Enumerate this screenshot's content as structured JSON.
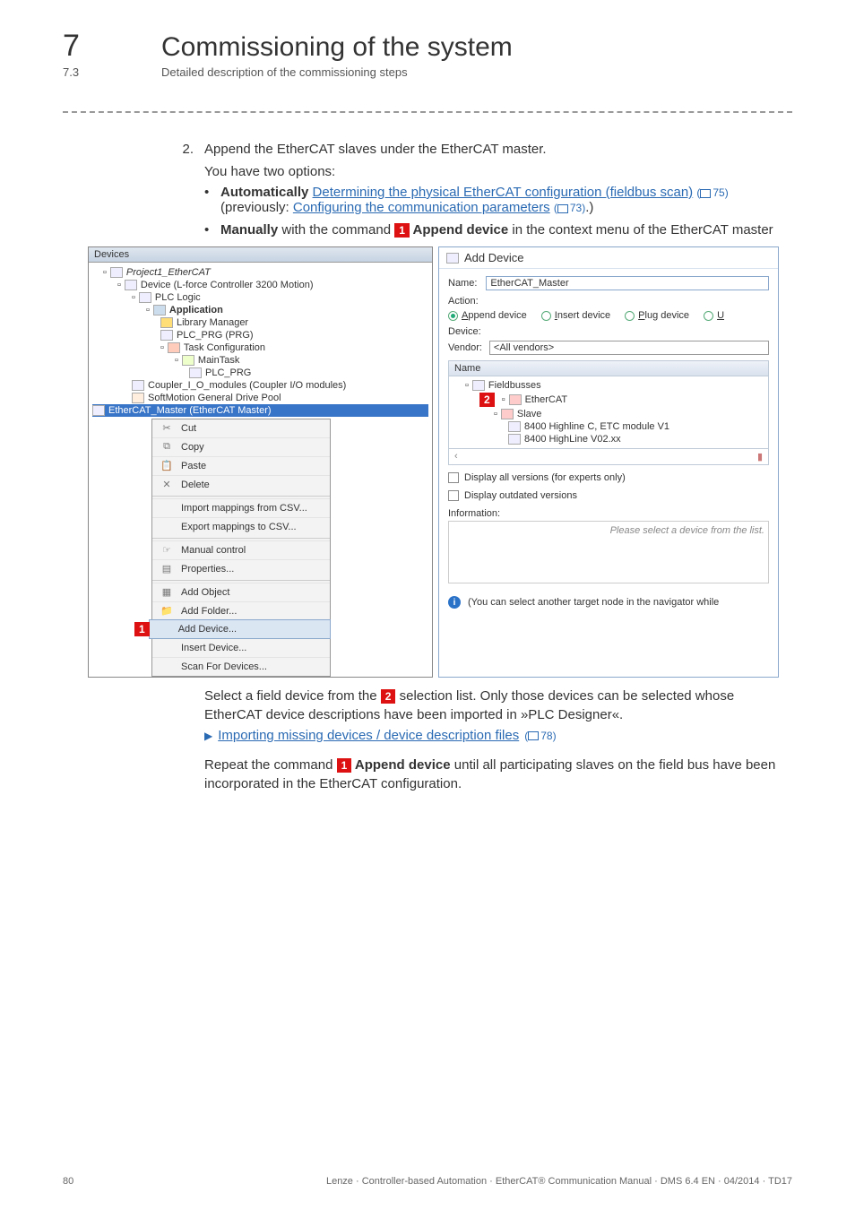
{
  "header": {
    "chapter_num": "7",
    "chapter_title": "Commissioning of the system",
    "section_num": "7.3",
    "section_title": "Detailed description of the commissioning steps"
  },
  "step": {
    "num": "2.",
    "text": "Append the EtherCAT slaves under the EtherCAT master.",
    "options_intro": "You have two options:",
    "auto_label": "Automatically",
    "auto_link": "Determining the physical EtherCAT configuration (fieldbus scan)",
    "auto_ref": "75",
    "prev_text": "(previously:",
    "prev_link": "Configuring the communication parameters",
    "prev_ref": "73",
    "prev_close": ".)",
    "manual_label": "Manually",
    "manual_text1": " with the command ",
    "callout1": "1",
    "manual_text2": "  Append device",
    "manual_text3": " in the context menu of the EtherCAT master"
  },
  "devices_panel": {
    "title": "Devices",
    "project": "Project1_EtherCAT",
    "device": "Device (L-force Controller 3200 Motion)",
    "plc_logic": "PLC Logic",
    "application": "Application",
    "library": "Library Manager",
    "plc_prg": "PLC_PRG (PRG)",
    "task_cfg": "Task Configuration",
    "main_task": "MainTask",
    "plc_prg_leaf": "PLC_PRG",
    "coupler": "Coupler_I_O_modules (Coupler I/O modules)",
    "softmotion": "SoftMotion General Drive Pool",
    "ethercat_master": "EtherCAT_Master (EtherCAT Master)",
    "ctx": {
      "cut": "Cut",
      "copy": "Copy",
      "paste": "Paste",
      "delete": "Delete",
      "import_csv": "Import mappings from CSV...",
      "export_csv": "Export mappings to CSV...",
      "manual_control": "Manual control",
      "properties": "Properties...",
      "add_object": "Add Object",
      "add_folder": "Add Folder...",
      "add_device": "Add Device...",
      "insert_device": "Insert Device...",
      "scan": "Scan For Devices..."
    }
  },
  "add_device": {
    "title": "Add Device",
    "name_label": "Name:",
    "name_value": "EtherCAT_Master",
    "action_label": "Action:",
    "r_append": "Append device",
    "r_insert": "Insert device",
    "r_plug": "Plug device",
    "r_update": "U",
    "device_label": "Device:",
    "vendor_label": "Vendor:",
    "vendor_value": "<All vendors>",
    "col_name": "Name",
    "fieldbusses": "Fieldbusses",
    "callout2": "2",
    "ethercat": "EtherCAT",
    "slave": "Slave",
    "dev1": "8400 Highline C, ETC module V1",
    "dev2": "8400 HighLine V02.xx",
    "scroll_left": "‹",
    "scroll_right": "…",
    "cb_expert": "Display all versions (for experts only)",
    "cb_outdated": "Display outdated versions",
    "info_label": "Information:",
    "info_placeholder": "Please select a device from the list.",
    "hint": "(You can select another target node in the navigator while"
  },
  "below": {
    "p1a": "Select a field device from the ",
    "callout2": "2",
    "p1b": "  selection list. Only those devices can be selected whose EtherCAT device descriptions have been imported in »PLC Designer«.",
    "import_link": "Importing missing devices / device description files",
    "import_ref": "78",
    "p2a": "Repeat the command ",
    "callout1": "1",
    "p2b": "  Append device",
    "p2c": " until all participating slaves on the field bus have been incorporated in the EtherCAT configuration."
  },
  "footer": {
    "page": "80",
    "line": "Lenze · Controller-based Automation · EtherCAT® Communication Manual · DMS 6.4 EN · 04/2014 · TD17"
  }
}
